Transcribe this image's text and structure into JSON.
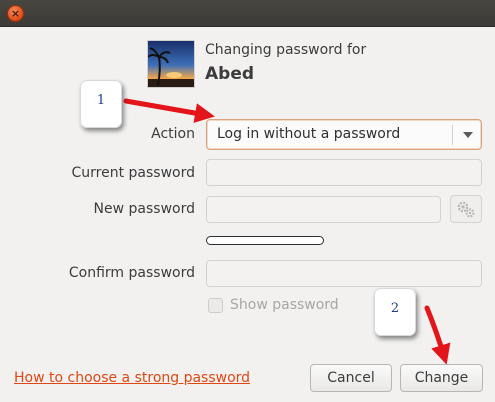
{
  "titlebar": {
    "close_icon": "close-icon"
  },
  "header": {
    "label": "Changing password for",
    "username": "Abed"
  },
  "form": {
    "action_label": "Action",
    "action_value": "Log in without a password",
    "current_password_label": "Current password",
    "new_password_label": "New password",
    "confirm_password_label": "Confirm password",
    "show_password_label": "Show password",
    "show_password_checked": false
  },
  "footer": {
    "help_link": "How to choose a strong password",
    "cancel_label": "Cancel",
    "change_label": "Change"
  },
  "annotations": {
    "callout_1": "1",
    "callout_2": "2"
  },
  "colors": {
    "link": "#dd4814",
    "close_button": "#df4a16",
    "annotation_arrow": "#e3151a"
  }
}
